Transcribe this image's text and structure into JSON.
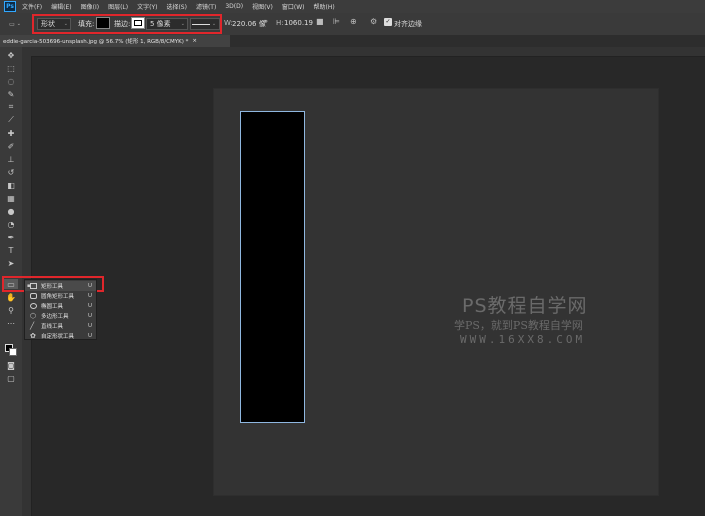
{
  "menubar": {
    "app_logo": "Ps",
    "items": [
      "文件(F)",
      "编辑(E)",
      "图像(I)",
      "图层(L)",
      "文字(Y)",
      "选择(S)",
      "滤镜(T)",
      "3D(D)",
      "视图(V)",
      "窗口(W)",
      "帮助(H)"
    ]
  },
  "options": {
    "mode": "形状",
    "fill_label": "填充:",
    "stroke_label": "描边:",
    "stroke_width": "5 像素",
    "w_label": "W:",
    "w_value": "220.06 像",
    "h_label": "H:",
    "h_value": "1060.19",
    "align_label": "对齐边缘",
    "fill_color": "#000000",
    "stroke_color": "#ffffff"
  },
  "document": {
    "tab_title": "eddie-garcia-503696-unsplash.jpg @ 56.7% (矩形 1, RGB/8/CMYK) *",
    "close": "×"
  },
  "flyout": {
    "items": [
      {
        "label": "矩形工具",
        "key": "U",
        "selected": true
      },
      {
        "label": "圆角矩形工具",
        "key": "U",
        "selected": false
      },
      {
        "label": "椭圆工具",
        "key": "U",
        "selected": false
      },
      {
        "label": "多边形工具",
        "key": "U",
        "selected": false
      },
      {
        "label": "直线工具",
        "key": "U",
        "selected": false
      },
      {
        "label": "自定形状工具",
        "key": "U",
        "selected": false
      }
    ]
  },
  "watermark": {
    "title": "PS教程自学网",
    "subtitle": "学PS，就到PS教程自学网",
    "url": "WWW.16XX8.COM"
  }
}
